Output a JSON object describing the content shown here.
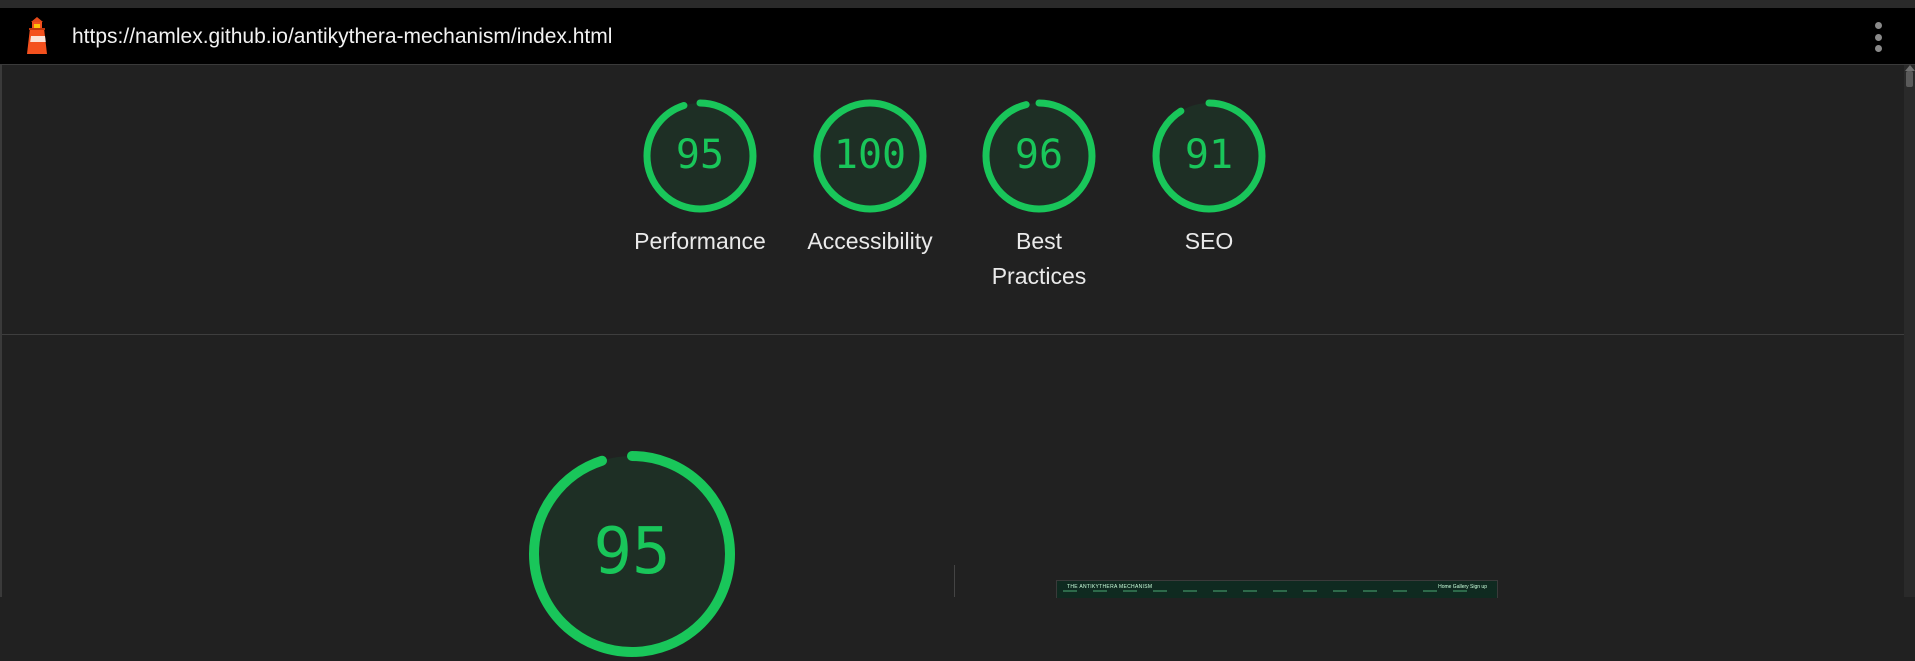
{
  "browser": {
    "url": "https://namlex.github.io/antikythera-mechanism/index.html",
    "logo_icon": "lighthouse-icon",
    "menu_icon": "kebab-menu-icon"
  },
  "colors": {
    "pass_green": "#19c65a",
    "gauge_fill": "#1e2f25",
    "background": "#212121",
    "urlbar": "#000000"
  },
  "scores": [
    {
      "id": "performance",
      "value": 95,
      "text": "95",
      "label": "Performance"
    },
    {
      "id": "accessibility",
      "value": 100,
      "text": "100",
      "label": "Accessibility"
    },
    {
      "id": "best-practices",
      "value": 96,
      "text": "96",
      "label": "Best Practices"
    },
    {
      "id": "seo",
      "value": 91,
      "text": "91",
      "label": "SEO"
    }
  ],
  "detail": {
    "score_value": 95,
    "score_text": "95",
    "screenshot_title": "THE ANTIKYTHERA MECHANISM",
    "screenshot_nav": "Home  Gallery  Sign up"
  }
}
